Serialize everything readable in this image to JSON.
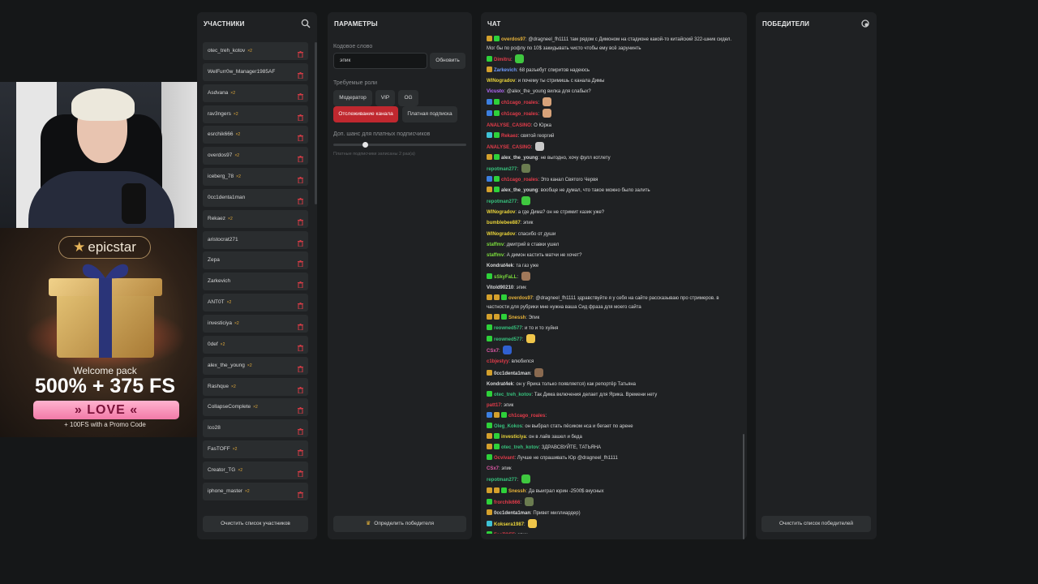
{
  "participants": {
    "title": "УЧАСТНИКИ",
    "search_icon": "search-icon",
    "trash_icon": "trash-icon",
    "clear_button": "Очистить список участников",
    "items": [
      {
        "name": "otec_treh_kotov",
        "badge": "×2"
      },
      {
        "name": "WelFurr0w_Manager1985AF",
        "badge": ""
      },
      {
        "name": "Asdvana",
        "badge": "×2"
      },
      {
        "name": "rav3ngers",
        "badge": "×2"
      },
      {
        "name": "esrchik666",
        "badge": "×2"
      },
      {
        "name": "overdos97",
        "badge": "×2"
      },
      {
        "name": "iceberg_78",
        "badge": "×2"
      },
      {
        "name": "0cc1denta1man",
        "badge": ""
      },
      {
        "name": "Rekaez",
        "badge": "×2"
      },
      {
        "name": "aristocrat271",
        "badge": ""
      },
      {
        "name": "Zepa",
        "badge": ""
      },
      {
        "name": "Zarkevich",
        "badge": ""
      },
      {
        "name": "ANT0T",
        "badge": "×2"
      },
      {
        "name": "investiciya",
        "badge": "×2"
      },
      {
        "name": "0def",
        "badge": "×2"
      },
      {
        "name": "alex_the_young",
        "badge": "×2"
      },
      {
        "name": "Rashque",
        "badge": "×2"
      },
      {
        "name": "CollapseComplete",
        "badge": "×2"
      },
      {
        "name": "Ico28",
        "badge": ""
      },
      {
        "name": "FasTOFF",
        "badge": "×2"
      },
      {
        "name": "Creator_TG",
        "badge": "×2"
      },
      {
        "name": "iphone_master",
        "badge": "×2"
      }
    ]
  },
  "params": {
    "title": "ПАРАМЕТРЫ",
    "keyword_label": "Кодовое слово",
    "keyword_value": "эпик",
    "update_button": "Обновить",
    "roles_label": "Требуемые роли",
    "roles": [
      "Модератор",
      "VIP",
      "OG"
    ],
    "tracking_button": "Отслеживание канала",
    "paid_sub_button": "Платная подписка",
    "chance_label": "Доп. шанс для платных подписчиков",
    "chance_level": 0.24,
    "chance_note": "Платные подписчики записаны 2 раз(а)",
    "pick_winner_button": "Определить победителя",
    "crown_icon": "crown-icon"
  },
  "chat": {
    "title": "ЧАТ",
    "messages": [
      {
        "icons": [
          "#d4a02c",
          "#2ed13a"
        ],
        "user": "overdos97",
        "color": "#e7b33a",
        "text": "@dragneel_fh1111 там рядом с Димоном на стадионе какой-то китайский 322-шник сидел. Мог бы по рофлу по 10$ закидывать чисто чтобы ему всё зарунинть",
        "wrap": true
      },
      {
        "icons": [
          "#2ed13a"
        ],
        "user": "Dimitru",
        "color": "#e33c4a",
        "text": "",
        "emote": "#3fc83f"
      },
      {
        "icons": [
          "#d4a02c"
        ],
        "user": "Zarkevich",
        "color": "#6f9bff",
        "text": "68 разъебут спиритов надеюсь"
      },
      {
        "icons": [],
        "user": "WINogradov",
        "color": "#e9d33a",
        "text": "и почему ты стримишь с канала Димы"
      },
      {
        "icons": [],
        "user": "Vicusto",
        "color": "#b86bff",
        "text": "@alex_the_young вилка для слабых?"
      },
      {
        "icons": [
          "#3c7fe0",
          "#2ed13a"
        ],
        "user": "ch1cago_roales",
        "color": "#e33c4a",
        "text": "",
        "emote": "#d8a37a"
      },
      {
        "icons": [
          "#3c7fe0",
          "#2ed13a"
        ],
        "user": "ch1cago_roales",
        "color": "#e33c4a",
        "text": "",
        "emote": "#d8a37a"
      },
      {
        "icons": [],
        "user": "ANALYSE_CASINO",
        "color": "#e33c4a",
        "text": "О Юрка"
      },
      {
        "icons": [
          "#3ec2d6",
          "#2ed13a"
        ],
        "user": "Rekaez",
        "color": "#e33c4a",
        "text": "святой георгий"
      },
      {
        "icons": [],
        "user": "ANALYSE_CASINO",
        "color": "#e33c4a",
        "text": "",
        "emote": "#c9c9c9"
      },
      {
        "icons": [
          "#d4a02c",
          "#2ed13a"
        ],
        "user": "alex_the_young",
        "color": "#d8d9da",
        "text": "не выгодно, хочу фулл котлету"
      },
      {
        "icons": [],
        "user": "repotman277",
        "color": "#37c07c",
        "text": "",
        "emote": "#6b7c50"
      },
      {
        "icons": [
          "#3c7fe0",
          "#2ed13a"
        ],
        "user": "ch1cago_roales",
        "color": "#e33c4a",
        "text": "Это канал Святого Червя"
      },
      {
        "icons": [
          "#d4a02c",
          "#2ed13a"
        ],
        "user": "alex_the_young",
        "color": "#d8d9da",
        "text": "вообще не думал, что такое можно было залить"
      },
      {
        "icons": [],
        "user": "repotman277",
        "color": "#37c07c",
        "text": "",
        "emote": "#3fc83f"
      },
      {
        "icons": [],
        "user": "WINogradov",
        "color": "#e9d33a",
        "text": "а где Дима? он не стримит казик уже?"
      },
      {
        "icons": [],
        "user": "bumblebee887",
        "color": "#e9d33a",
        "text": "эпик"
      },
      {
        "icons": [],
        "user": "WINogradov",
        "color": "#e9d33a",
        "text": "спасибо от души"
      },
      {
        "icons": [],
        "user": "staffmv",
        "color": "#7bdc3c",
        "text": "дмитрий в ставки ушел"
      },
      {
        "icons": [],
        "user": "staffmv",
        "color": "#7bdc3c",
        "text": "А димон кастить матчи не хочет?"
      },
      {
        "icons": [],
        "user": "Kondrat4ek",
        "color": "#d8d9da",
        "text": "та газ уже"
      },
      {
        "icons": [
          "#2ed13a"
        ],
        "user": "sSkyFaLL",
        "color": "#7bdc3c",
        "text": "",
        "emote": "#a0785a"
      },
      {
        "icons": [],
        "user": "Vitold90210",
        "color": "#d8d9da",
        "text": "эпик"
      },
      {
        "icons": [
          "#d4a02c",
          "#d4a02c",
          "#2ed13a"
        ],
        "user": "overdos97",
        "color": "#e7b33a",
        "text": "@dragneel_fh1111 здравствуйте я у себя на сайте рассказываю про стримеров. в частности для рубрики мне нужна ваша Сид фраза для моего сайта",
        "wrap": true
      },
      {
        "icons": [
          "#d4a02c",
          "#d4a02c",
          "#2ed13a"
        ],
        "user": "Snessh",
        "color": "#e7b33a",
        "text": "Эпик"
      },
      {
        "icons": [
          "#2ed13a"
        ],
        "user": "reowned577",
        "color": "#37c07c",
        "text": "и то и то хуйня"
      },
      {
        "icons": [
          "#2ed13a"
        ],
        "user": "reowned577",
        "color": "#37c07c",
        "text": "",
        "emote": "#f0c64a"
      },
      {
        "icons": [],
        "user": "CSx7",
        "color": "#e05aa8",
        "text": "",
        "emote": "#3060d0"
      },
      {
        "icons": [],
        "user": "c1bjestyy",
        "color": "#e33c4a",
        "text": "влюбился"
      },
      {
        "icons": [
          "#d4a02c"
        ],
        "user": "0cc1denta1man",
        "color": "#d8d9da",
        "text": "",
        "emote": "#8a6a50"
      },
      {
        "icons": [],
        "user": "Kondrat4ek",
        "color": "#d8d9da",
        "text": "он у Ярика только появляется) как репортёр Татьяна"
      },
      {
        "icons": [
          "#2ed13a"
        ],
        "user": "otec_treh_kotov",
        "color": "#37c07c",
        "text": "Так Дима включения делает для Ярика. Времени нету"
      },
      {
        "icons": [],
        "user": "patt17",
        "color": "#e33c4a",
        "text": "эпик"
      },
      {
        "icons": [
          "#3c7fe0",
          "#d4a02c",
          "#2ed13a"
        ],
        "user": "ch1cago_roales",
        "color": "#e33c4a",
        "text": ""
      },
      {
        "icons": [
          "#2ed13a"
        ],
        "user": "Oleg_Kokos",
        "color": "#37c07c",
        "text": "он выбрал стать пёсиком нса и бегает по арене"
      },
      {
        "icons": [
          "#d4a02c",
          "#2ed13a"
        ],
        "user": "investiciya",
        "color": "#e9d33a",
        "text": "он в лайв зашел и беда"
      },
      {
        "icons": [
          "#d4a02c",
          "#2ed13a"
        ],
        "user": "otec_treh_kotov",
        "color": "#37c07c",
        "text": "ЗДРАВСВУЙТЕ, ТАТЬЯНА"
      },
      {
        "icons": [
          "#2ed13a"
        ],
        "user": "Ocvivant",
        "color": "#e33c4a",
        "text": "Лучше не спрашивать Юр @dragneel_fh1111"
      },
      {
        "icons": [],
        "user": "CSx7",
        "color": "#e05aa8",
        "text": "эпик"
      },
      {
        "icons": [],
        "user": "repotman277",
        "color": "#37c07c",
        "text": "",
        "emote": "#3fc83f"
      },
      {
        "icons": [
          "#d4a02c",
          "#d4a02c",
          "#2ed13a"
        ],
        "user": "Snessh",
        "color": "#e7b33a",
        "text": "Да выиграл юрин -2500$ вкусных"
      },
      {
        "icons": [
          "#2ed13a"
        ],
        "user": "frorchik666",
        "color": "#e33c4a",
        "text": "",
        "emote": "#6b7c50"
      },
      {
        "icons": [
          "#d4a02c"
        ],
        "user": "0cc1denta1man",
        "color": "#d8d9da",
        "text": "Привет миллиардер)"
      },
      {
        "icons": [
          "#3ec2d6"
        ],
        "user": "Koksera1987",
        "color": "#e9d33a",
        "text": "",
        "emote": "#f0c64a"
      },
      {
        "icons": [
          "#2ed13a"
        ],
        "user": "FasTOFF",
        "color": "#e33c4a",
        "text": "эпик"
      }
    ]
  },
  "winners": {
    "title": "ПОБЕДИТЕЛИ",
    "icon": "refresh-icon",
    "clear_button": "Очистить список победителей"
  },
  "ad": {
    "brand": "epicstar",
    "welcome": "Welcome pack",
    "offer": "500% + 375 FS",
    "code": "» LOVE «",
    "promo": "+ 100FS with a Promo Code"
  }
}
